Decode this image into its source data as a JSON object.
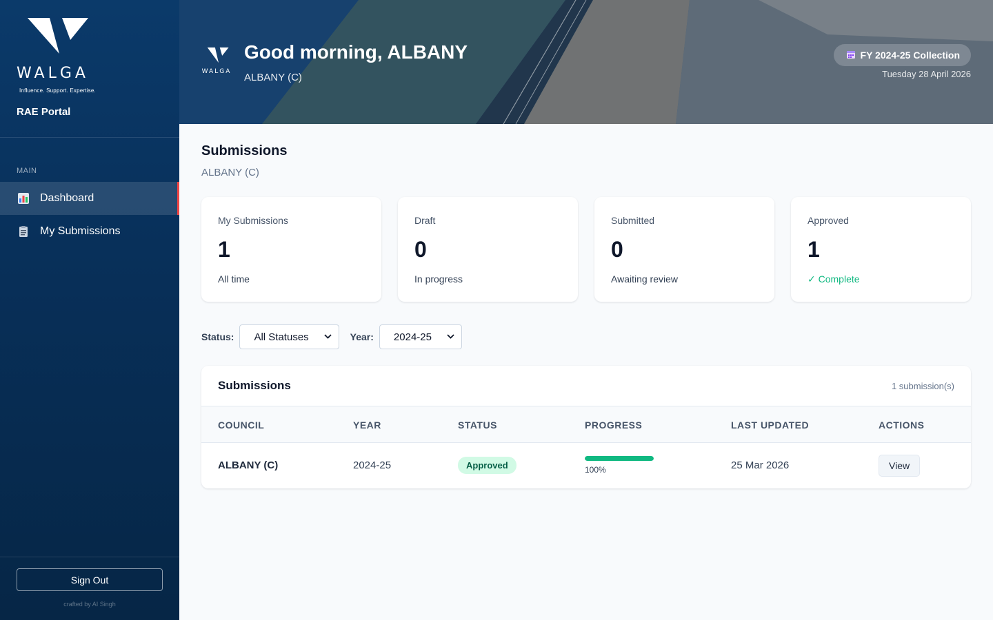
{
  "sidebar": {
    "logo_word": "WALGA",
    "logo_tagline": "Influence. Support. Expertise.",
    "portal_name": "RAE Portal",
    "section_label": "MAIN",
    "items": [
      {
        "label": "Dashboard",
        "icon": "bar-chart-icon",
        "active": true
      },
      {
        "label": "My Submissions",
        "icon": "clipboard-icon",
        "active": false
      }
    ],
    "sign_out_label": "Sign Out",
    "crafted_by": "crafted by AI Singh"
  },
  "hero": {
    "logo_word": "WALGA",
    "greeting": "Good morning, ALBANY",
    "council": "ALBANY (C)",
    "fy_badge": "FY 2024-25 Collection",
    "date": "Tuesday 28 April 2026"
  },
  "page": {
    "title": "Submissions",
    "subtitle": "ALBANY (C)"
  },
  "stats": [
    {
      "label": "My Submissions",
      "value": "1",
      "note": "All time"
    },
    {
      "label": "Draft",
      "value": "0",
      "note": "In progress"
    },
    {
      "label": "Submitted",
      "value": "0",
      "note": "Awaiting review"
    },
    {
      "label": "Approved",
      "value": "1",
      "note": "✓ Complete"
    }
  ],
  "filters": {
    "status_label": "Status:",
    "status_value": "All Statuses",
    "year_label": "Year:",
    "year_value": "2024-25"
  },
  "table": {
    "title": "Submissions",
    "count": "1 submission(s)",
    "columns": [
      "COUNCIL",
      "YEAR",
      "STATUS",
      "PROGRESS",
      "LAST UPDATED",
      "ACTIONS"
    ],
    "rows": [
      {
        "council": "ALBANY (C)",
        "year": "2024-25",
        "status": "Approved",
        "progress": 1.0,
        "progress_text": "100%",
        "last_updated": "25 Mar 2026",
        "action": "View"
      }
    ]
  },
  "colors": {
    "sidebar": "#0b3a6a",
    "accent_active": "#ef4444",
    "success": "#10b981",
    "badge_bg": "#d1fae5"
  }
}
